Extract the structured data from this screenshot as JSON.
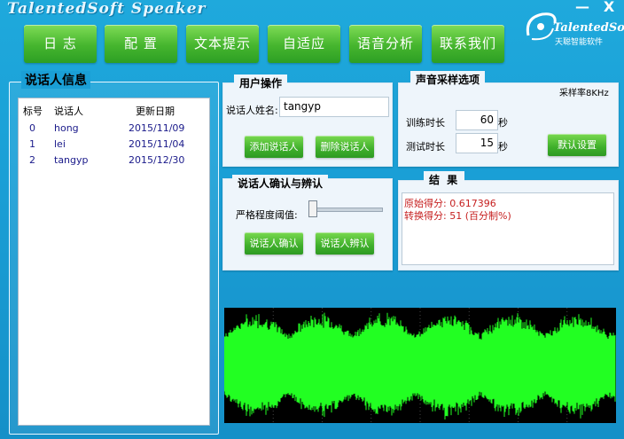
{
  "app_title": "TalentedSoft Speaker",
  "logo": {
    "name": "TalentedSoft",
    "subtitle": "天聪智能软件"
  },
  "window_controls": {
    "minimize": "—",
    "close": "X"
  },
  "nav": [
    "日 志",
    "配 置",
    "文本提示",
    "自适应",
    "语音分析",
    "联系我们"
  ],
  "speaker_info": {
    "title": "说话人信息",
    "columns": [
      "标号",
      "说话人",
      "更新日期"
    ],
    "rows": [
      {
        "id": "0",
        "name": "hong",
        "date": "2015/11/09"
      },
      {
        "id": "1",
        "name": "lei",
        "date": "2015/11/04"
      },
      {
        "id": "2",
        "name": "tangyp",
        "date": "2015/12/30"
      }
    ]
  },
  "user_ops": {
    "title": "用户操作",
    "name_label": "说话人姓名:",
    "name_value": "tangyp",
    "add_btn": "添加说话人",
    "delete_btn": "删除说话人"
  },
  "sampling": {
    "title": "声音采样选项",
    "rate_label": "采样率8KHz",
    "train_label": "训练时长",
    "train_value": "60",
    "test_label": "测试时长",
    "test_value": "15",
    "unit": "秒",
    "default_btn": "默认设置"
  },
  "verify": {
    "title": "说话人确认与辨认",
    "threshold_label": "严格程度阈值:",
    "confirm_btn": "说话人确认",
    "identify_btn": "说话人辨认"
  },
  "result": {
    "title": "结 果",
    "line1": "原始得分: 0.617396",
    "line2": "转换得分: 51 (百分制%)",
    "color": "#c62020"
  },
  "waveform": {
    "color": "#22ff22",
    "background": "#000000"
  }
}
